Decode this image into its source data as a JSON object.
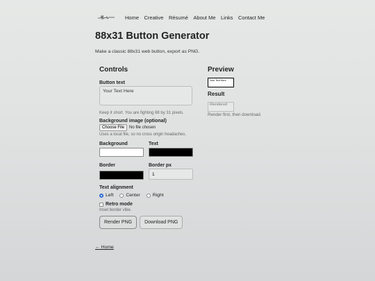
{
  "nav": {
    "logo_icon": "signature-logo-icon",
    "links": [
      "Home",
      "Creative",
      "Résumé",
      "About Me",
      "Links",
      "Contact Me"
    ]
  },
  "page": {
    "title": "88x31 Button Generator",
    "subtitle": "Make a classic 88x31 web button, export as PNG."
  },
  "controls": {
    "heading": "Controls",
    "button_text_label": "Button text",
    "button_text_value": "Your Text Here",
    "button_text_hint": "Keep it short. You are fighting 88 by 31 pixels.",
    "bg_image_label": "Background image (optional)",
    "choose_file_label": "Choose File",
    "no_file_text": "No file chosen",
    "bg_image_hint": "Uses a local file, so no cross origin headaches.",
    "background_label": "Background",
    "background_color": "#ffffff",
    "text_label": "Text",
    "text_color": "#000000",
    "border_label": "Border",
    "border_color": "#000000",
    "border_px_label": "Border px",
    "border_px_value": "1",
    "alignment_label": "Text alignment",
    "alignment_options": [
      "Left",
      "Center",
      "Right"
    ],
    "alignment_selected": "Left",
    "retro_label": "Retro mode",
    "retro_hint": "Inset border vibe.",
    "render_button": "Render PNG",
    "download_button": "Download PNG"
  },
  "preview": {
    "heading": "Preview",
    "preview_text": "Your Text Here",
    "result_heading": "Result",
    "result_alt": "Rendered",
    "result_hint": "Render first, then download."
  },
  "footer": {
    "back_link": "← Home"
  },
  "colors": {
    "accent": "#2f6bd8"
  }
}
